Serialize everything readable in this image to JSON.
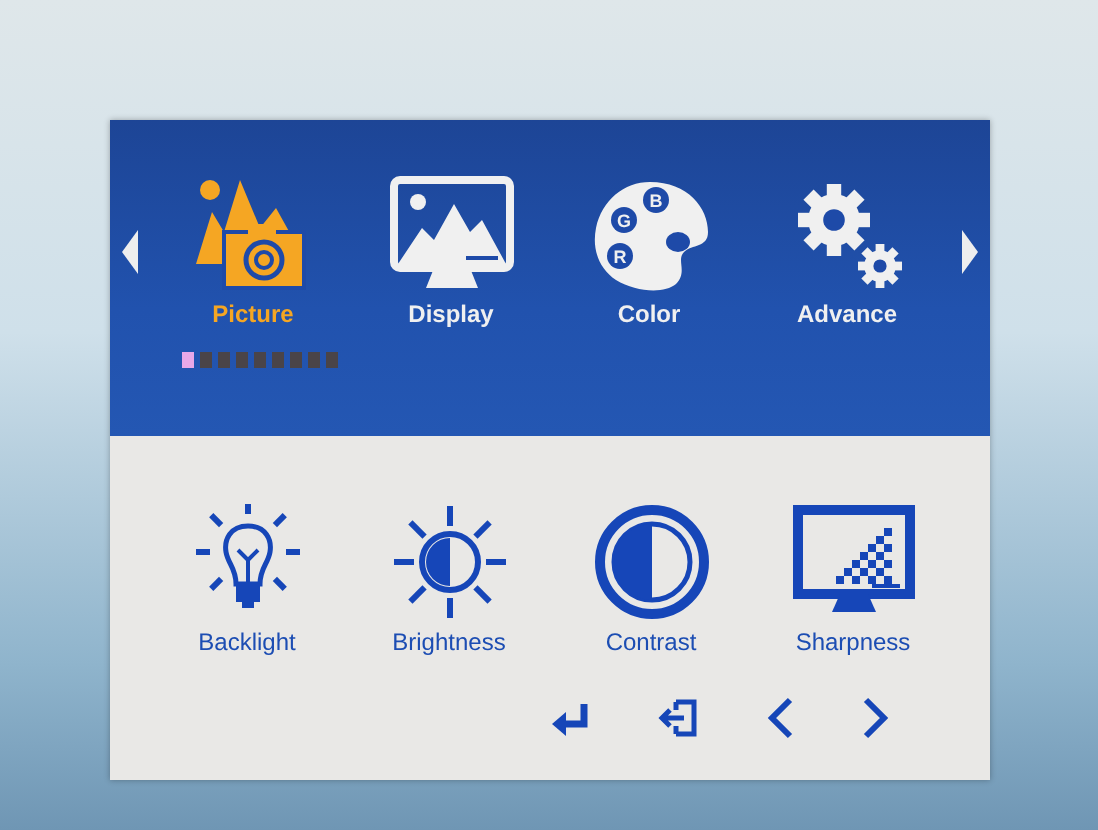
{
  "categories": [
    {
      "kind": "picture",
      "label": "Picture",
      "selected": true
    },
    {
      "kind": "display",
      "label": "Display",
      "selected": false
    },
    {
      "kind": "color",
      "label": "Color",
      "selected": false,
      "badges": [
        "B",
        "G",
        "R"
      ]
    },
    {
      "kind": "advance",
      "label": "Advance",
      "selected": false
    }
  ],
  "page_dots": [
    {
      "selected": true
    },
    {
      "selected": false
    },
    {
      "selected": false
    },
    {
      "selected": false
    },
    {
      "selected": false
    },
    {
      "selected": false
    },
    {
      "selected": false
    },
    {
      "selected": false
    },
    {
      "selected": false
    }
  ],
  "items": [
    {
      "kind": "backlight",
      "label": "Backlight"
    },
    {
      "kind": "brightness",
      "label": "Brightness"
    },
    {
      "kind": "contrast",
      "label": "Contrast"
    },
    {
      "kind": "sharpness",
      "label": "Sharpness"
    }
  ],
  "footer": [
    {
      "kind": "enter"
    },
    {
      "kind": "exit"
    },
    {
      "kind": "left"
    },
    {
      "kind": "right"
    }
  ]
}
